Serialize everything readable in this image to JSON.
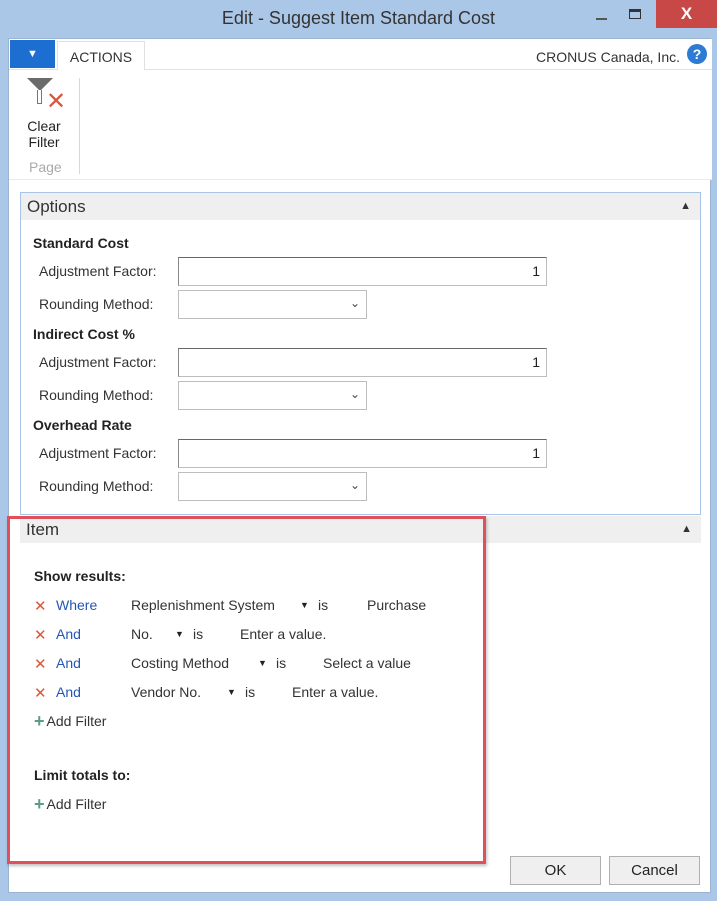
{
  "window": {
    "title": "Edit - Suggest Item Standard Cost",
    "controls": {
      "minimize": "minimize-icon",
      "maximize": "maximize-icon",
      "close_glyph": "X"
    }
  },
  "ribbon": {
    "app_menu_glyph": "▼",
    "tabs": [
      {
        "label": "ACTIONS",
        "active": true
      }
    ],
    "company": "CRONUS Canada, Inc.",
    "help_glyph": "?",
    "actions": [
      {
        "label_line1": "Clear",
        "label_line2": "Filter",
        "icon": "clear-filter-icon"
      }
    ],
    "group_label": "Page"
  },
  "options": {
    "header": "Options",
    "collapse_glyph": "▲",
    "groups": [
      {
        "title": "Standard Cost",
        "adjustment_label": "Adjustment Factor:",
        "adjustment_value": "1",
        "rounding_label": "Rounding Method:",
        "rounding_value": ""
      },
      {
        "title": "Indirect Cost %",
        "adjustment_label": "Adjustment Factor:",
        "adjustment_value": "1",
        "rounding_label": "Rounding Method:",
        "rounding_value": ""
      },
      {
        "title": "Overhead Rate",
        "adjustment_label": "Adjustment Factor:",
        "adjustment_value": "1",
        "rounding_label": "Rounding Method:",
        "rounding_value": ""
      }
    ]
  },
  "item": {
    "header": "Item",
    "collapse_glyph": "▲",
    "show_results_label": "Show results:",
    "filters": [
      {
        "conj": "Where",
        "field": "Replenishment System",
        "op": "is",
        "value": "Purchase"
      },
      {
        "conj": "And",
        "field": "No.",
        "op": "is",
        "value": "Enter a value."
      },
      {
        "conj": "And",
        "field": "Costing Method",
        "op": "is",
        "value": "Select a value"
      },
      {
        "conj": "And",
        "field": "Vendor No.",
        "op": "is",
        "value": "Enter a value."
      }
    ],
    "add_filter_label": "Add Filter",
    "limit_totals_label": "Limit totals to:",
    "limit_add_filter_label": "Add Filter"
  },
  "buttons": {
    "ok": "OK",
    "cancel": "Cancel"
  },
  "colors": {
    "accent": "#1c6fd0",
    "highlight_border": "#e0505a",
    "remove_red": "#d9573b",
    "link_blue": "#2456b3",
    "add_green": "#5a9e82"
  }
}
